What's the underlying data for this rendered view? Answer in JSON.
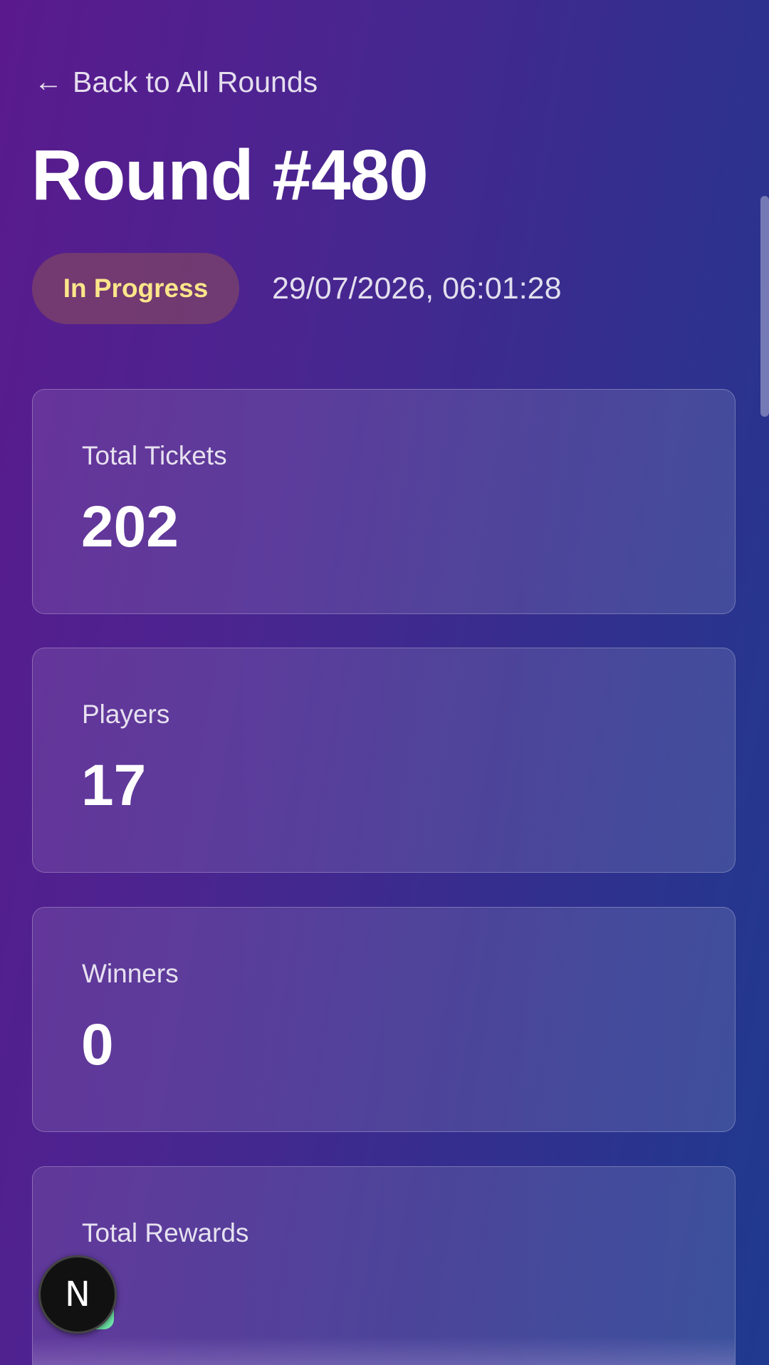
{
  "back_link": {
    "icon": "arrow-left-icon",
    "label": "Back to All Rounds",
    "arrow": "←"
  },
  "title": "Round #480",
  "status": {
    "label": "In Progress",
    "color": "#fde68a"
  },
  "timestamp": "29/07/2026, 06:01:28",
  "stats": [
    {
      "label": "Total Tickets",
      "value": "202"
    },
    {
      "label": "Players",
      "value": "17"
    },
    {
      "label": "Winners",
      "value": "0"
    },
    {
      "label": "Total Rewards",
      "value": ""
    }
  ],
  "dev_badge": {
    "icon": "nextjs-logo-icon",
    "letter": "N"
  },
  "colors": {
    "background_start": "#5a1a8e",
    "background_end": "#1f3a8f",
    "status_text": "#fde68a",
    "accent_green": "#6ee7a8"
  }
}
